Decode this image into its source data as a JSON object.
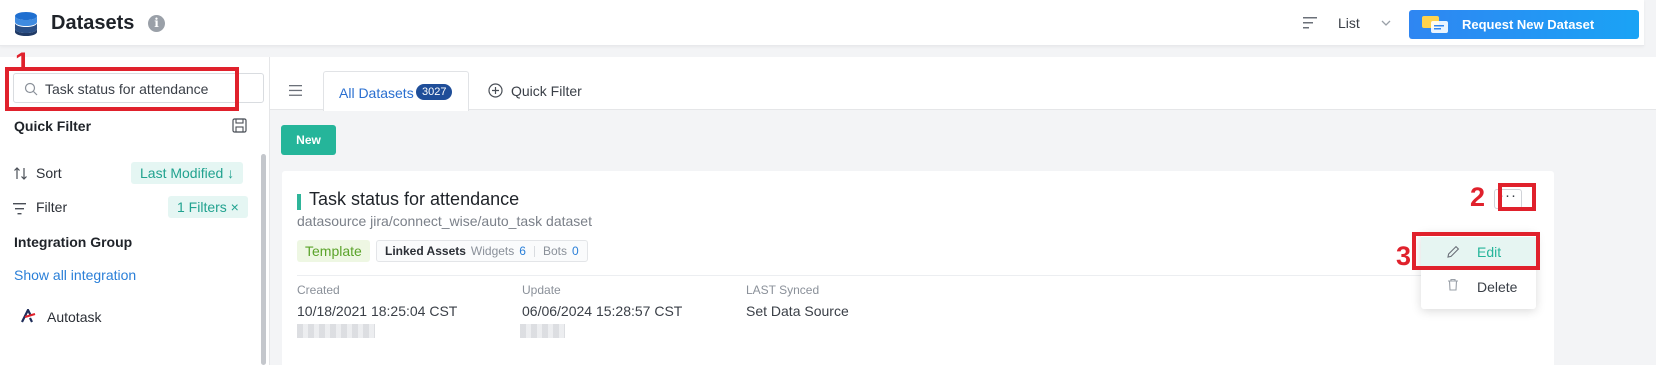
{
  "header": {
    "title": "Datasets",
    "info_icon": "info-icon",
    "view_label": "List",
    "request_button": "Request New Dataset"
  },
  "sidebar": {
    "search_value": "Task status for attendance",
    "quick_filter_title": "Quick Filter",
    "sort_label": "Sort",
    "sort_value": "Last Modified ↓",
    "filter_label": "Filter",
    "filter_value": "1 Filters ×",
    "integration_group_title": "Integration Group",
    "show_all_label": "Show all integration",
    "integrations": [
      {
        "label": "Autotask"
      }
    ]
  },
  "tabs": {
    "all_label": "All Datasets",
    "all_count": "3027",
    "quick_filter_label": "Quick Filter"
  },
  "toolbar": {
    "new_label": "New"
  },
  "card": {
    "title": "Task status for attendance",
    "subtitle": "datasource jira/connect_wise/auto_task dataset",
    "template_tag": "Template",
    "linked_assets_label": "Linked Assets",
    "widgets_label": "Widgets",
    "widgets_count": "6",
    "bots_label": "Bots",
    "bots_count": "0",
    "created_label": "Created",
    "created_value": "10/18/2021 18:25:04 CST",
    "update_label": "Update",
    "update_value": "06/06/2024 15:28:57 CST",
    "synced_label": "LAST Synced",
    "synced_value": "Set Data Source",
    "more_label": "···"
  },
  "menu": {
    "edit_label": "Edit",
    "delete_label": "Delete"
  },
  "annotations": {
    "step1": "1",
    "step2": "2",
    "step3": "3"
  },
  "colors": {
    "accent": "#25b59a",
    "primary": "#2f86f2",
    "highlight": "#e0212c"
  }
}
